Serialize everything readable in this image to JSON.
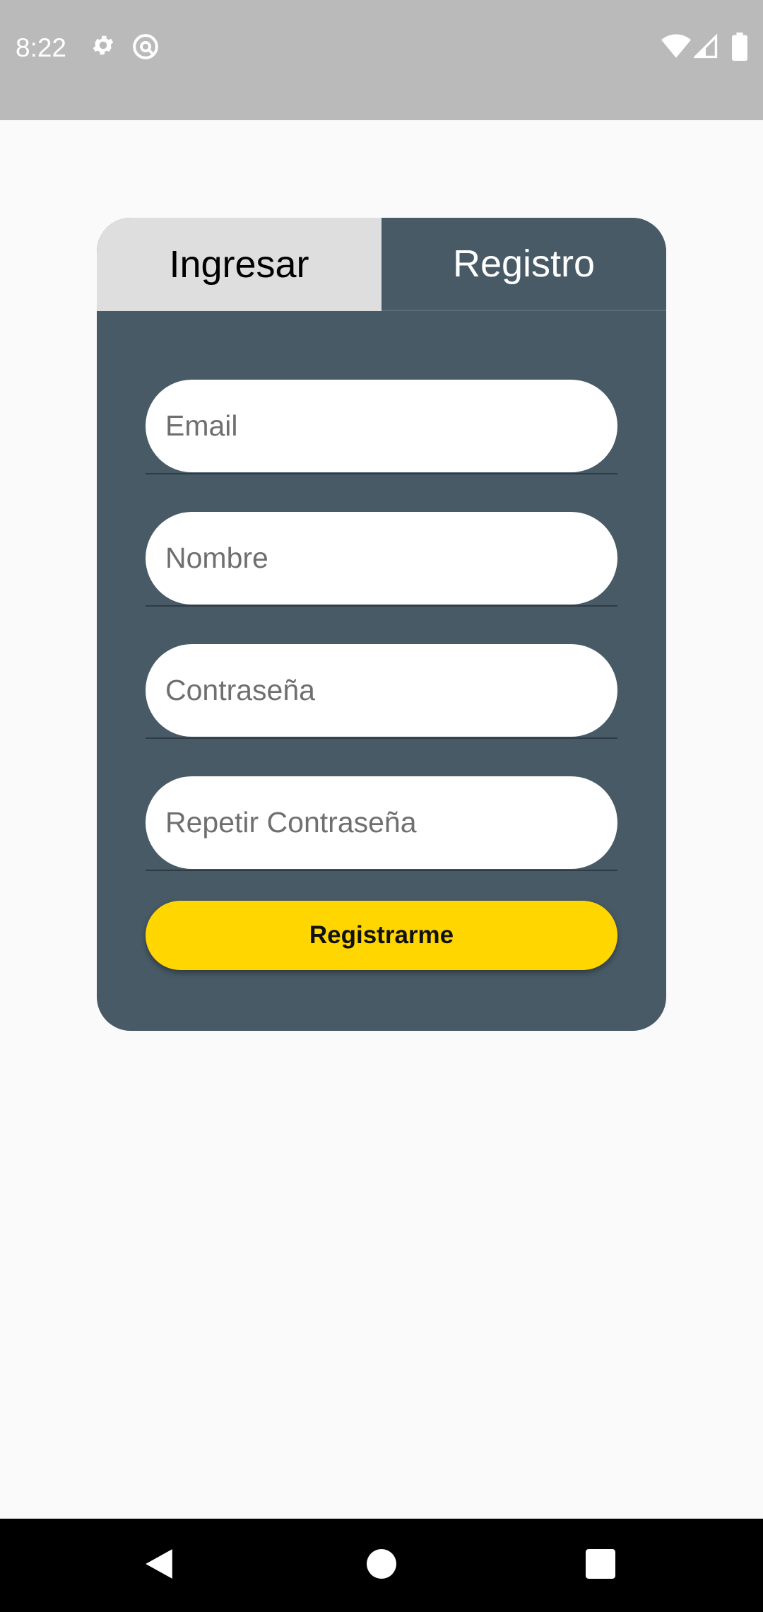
{
  "status_bar": {
    "time": "8:22",
    "icons_left": [
      "gear-icon",
      "at-sign-icon"
    ],
    "icons_right": [
      "wifi-icon",
      "signal-icon",
      "battery-icon"
    ],
    "background": "#bababa"
  },
  "tabs": {
    "login_label": "Ingresar",
    "register_label": "Registro",
    "active": "Registro"
  },
  "form": {
    "email_placeholder": "Email",
    "email_value": "",
    "name_placeholder": "Nombre",
    "name_value": "",
    "password_placeholder": "Contraseña",
    "password_value": "",
    "repeat_password_placeholder": "Repetir Contraseña",
    "repeat_password_value": "",
    "submit_label": "Registrarme"
  },
  "colors": {
    "card": "#475a66",
    "inactive_tab": "#dedede",
    "accent": "#ffd600",
    "background": "#fafafa"
  },
  "nav_bar": {
    "buttons": [
      "back-icon",
      "home-icon",
      "recents-icon"
    ]
  }
}
